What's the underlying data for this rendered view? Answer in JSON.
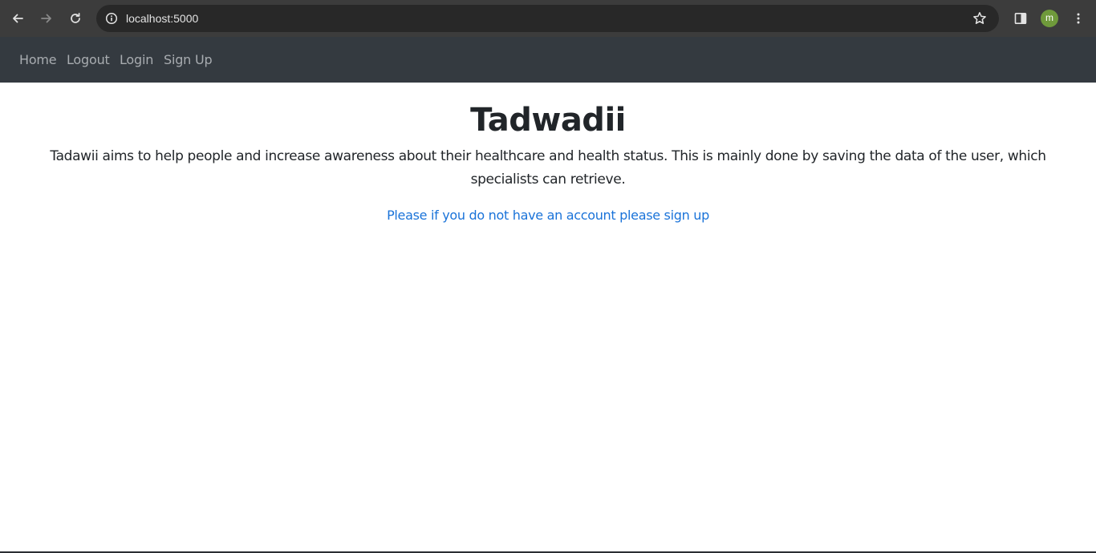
{
  "browser": {
    "url": "localhost:5000",
    "avatar_letter": "m",
    "avatar_color": "#6f9a3b",
    "icons": {
      "back": "arrow-left-icon",
      "forward": "arrow-right-icon",
      "reload": "reload-icon",
      "site_info": "info-icon",
      "bookmark": "star-icon",
      "side_panel": "side-panel-icon",
      "menu": "kebab-menu-icon"
    }
  },
  "navbar": {
    "background": "#343a40",
    "links": [
      {
        "label": "Home"
      },
      {
        "label": "Logout"
      },
      {
        "label": "Login"
      },
      {
        "label": "Sign Up"
      }
    ]
  },
  "main": {
    "title": "Tadwadii",
    "intro": "Tadawii aims to help people and increase awareness about their healthcare and health status. This is mainly done by saving the data of the user, which specialists can retrieve.",
    "signup_link": "Please if you do not have an account please sign up",
    "link_color": "#1a73d9"
  }
}
